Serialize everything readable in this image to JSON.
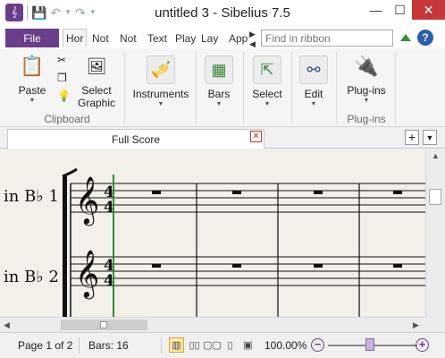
{
  "window": {
    "title": "untitled 3 - Sibelius 7.5",
    "min_glyph": "—",
    "max_glyph": "☐",
    "close_glyph": "✕"
  },
  "ribbon_tabs": [
    {
      "label": "File"
    },
    {
      "label": "Hor"
    },
    {
      "label": "Not"
    },
    {
      "label": "Not"
    },
    {
      "label": "Text"
    },
    {
      "label": "Play"
    },
    {
      "label": "Lay"
    },
    {
      "label": "App"
    }
  ],
  "ribbon_search": {
    "placeholder": "Find in ribbon"
  },
  "ribbon": {
    "paste": {
      "label": "Paste"
    },
    "select_graphic": {
      "label1": "Select",
      "label2": "Graphic"
    },
    "clipboard_group": "Clipboard",
    "instruments": {
      "label": "Instruments"
    },
    "bars": {
      "label": "Bars"
    },
    "select": {
      "label": "Select"
    },
    "edit": {
      "label": "Edit"
    },
    "plugins": {
      "label": "Plug-ins"
    },
    "plugins_group": "Plug-ins"
  },
  "document_tab": {
    "label": "Full Score",
    "close_glyph": "✕"
  },
  "score": {
    "staves": [
      {
        "name": "in B♭ 1"
      },
      {
        "name": "in B♭ 2"
      }
    ],
    "time_signature": {
      "top": "4",
      "bottom": "4"
    }
  },
  "statusbar": {
    "page": "Page 1 of 2",
    "bars": "Bars: 16",
    "zoom": "100.00%"
  },
  "colors": {
    "accent": "#6a3e8a",
    "close_red": "#c7373a",
    "paper": "#f3efe9",
    "playline": "#2f8a3a"
  }
}
